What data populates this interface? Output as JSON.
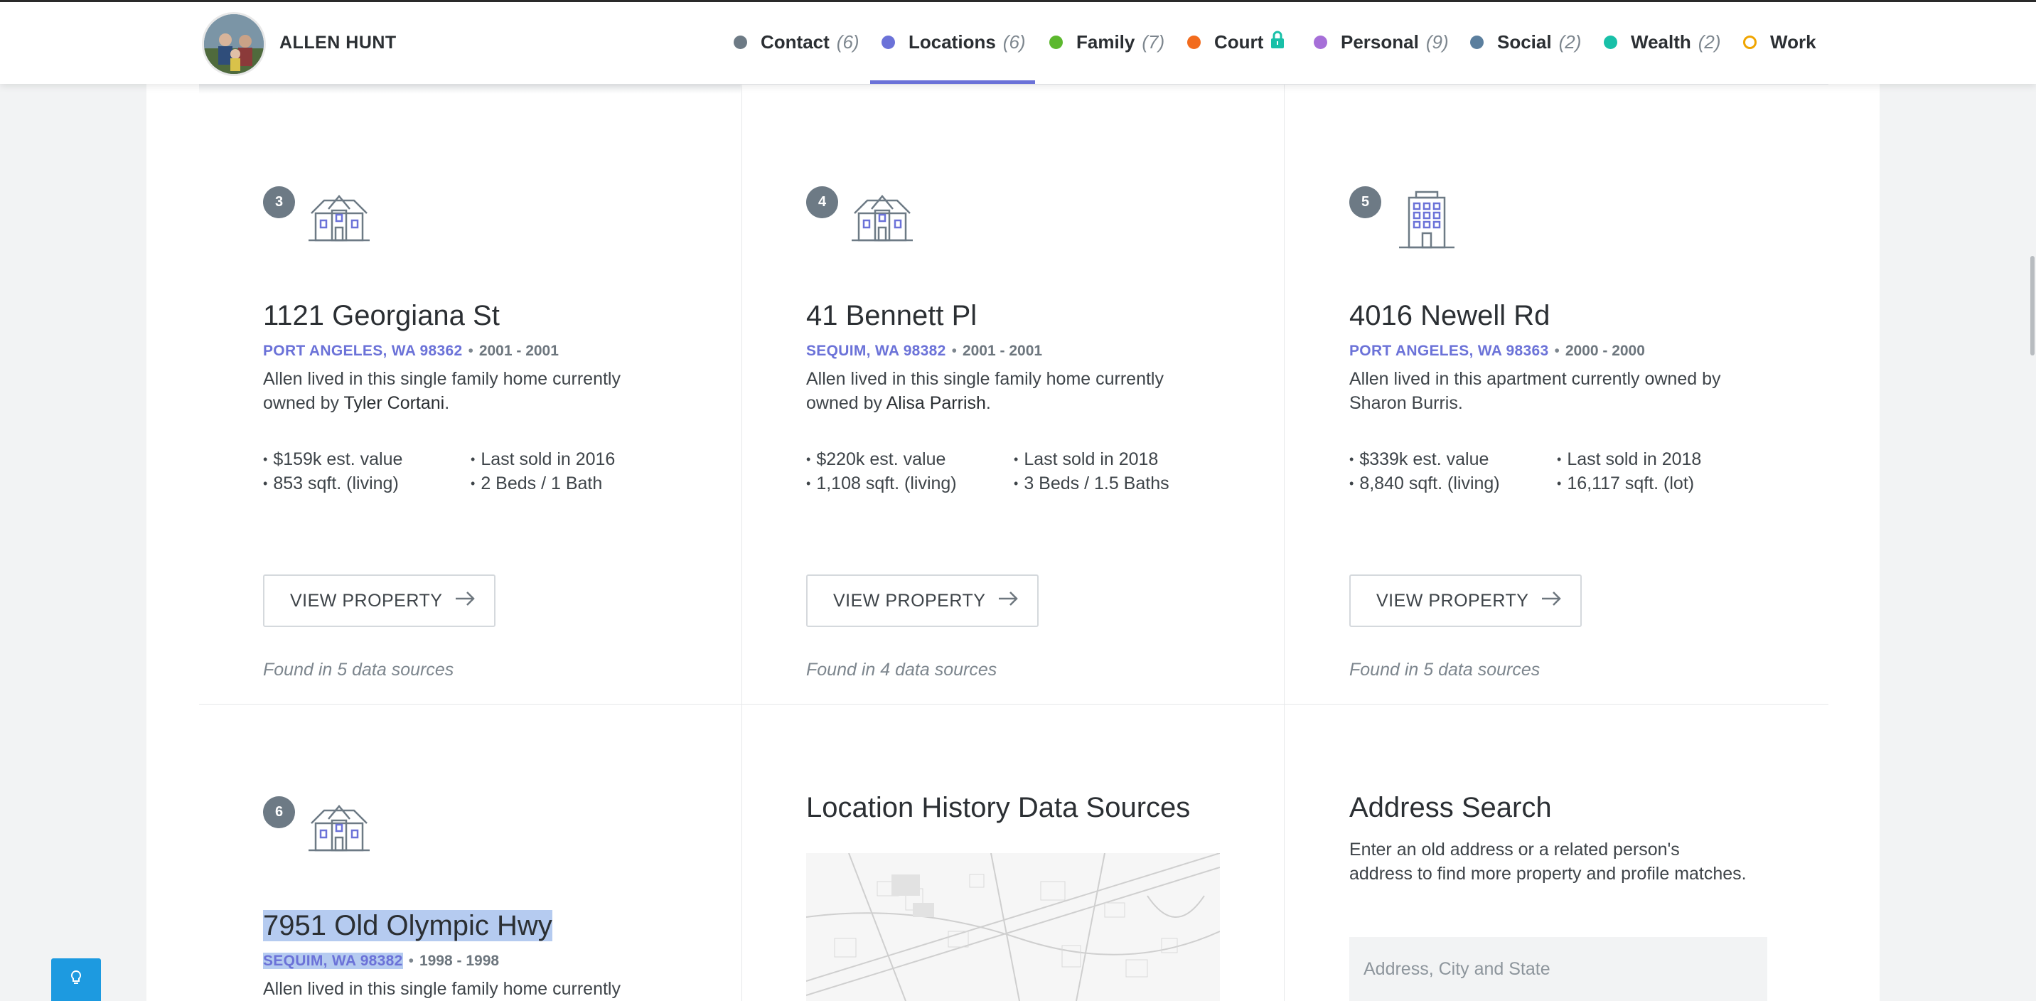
{
  "header": {
    "person_name": "ALLEN HUNT",
    "nav": [
      {
        "label": "Contact",
        "count": "(6)",
        "color": "#6d7a85"
      },
      {
        "label": "Locations",
        "count": "(6)",
        "color": "#6b72d8",
        "active": true
      },
      {
        "label": "Family",
        "count": "(7)",
        "color": "#5cb82e"
      },
      {
        "label": "Court",
        "count": "",
        "color": "#f26b1d",
        "icon": "lock-icon"
      },
      {
        "label": "Personal",
        "count": "(9)",
        "color": "#a66fd8"
      },
      {
        "label": "Social",
        "count": "(2)",
        "color": "#5b7f9e"
      },
      {
        "label": "Wealth",
        "count": "(2)",
        "color": "#18c0a8"
      },
      {
        "label": "Work",
        "count": "",
        "color": "#f0a500"
      }
    ]
  },
  "locations": [
    {
      "number": "3",
      "icon": "house-icon",
      "address": "1121 Georgiana St",
      "city": "PORT ANGELES, WA 98362",
      "years": "2001 - 2001",
      "desc_prefix": "Allen lived in this single family home currently owned by ",
      "owner": "Tyler Cortani",
      "desc_suffix": ".",
      "facts": [
        "$159k est. value",
        "Last sold in 2016",
        "853 sqft. (living)",
        "2 Beds / 1 Bath"
      ],
      "button": "VIEW PROPERTY",
      "sources": "Found in 5 data sources"
    },
    {
      "number": "4",
      "icon": "house-icon",
      "address": "41 Bennett Pl",
      "city": "SEQUIM, WA 98382",
      "years": "2001 - 2001",
      "desc_prefix": "Allen lived in this single family home currently owned by ",
      "owner": "Alisa Parrish",
      "desc_suffix": ".",
      "facts": [
        "$220k est. value",
        "Last sold in 2018",
        "1,108 sqft. (living)",
        "3 Beds / 1.5 Baths"
      ],
      "button": "VIEW PROPERTY",
      "sources": "Found in 4 data sources"
    },
    {
      "number": "5",
      "icon": "apartment-building-icon",
      "address": "4016 Newell Rd",
      "city": "PORT ANGELES, WA 98363",
      "years": "2000 - 2000",
      "desc_prefix": "Allen lived in this apartment currently owned by Sharon Burris.",
      "owner": "",
      "desc_suffix": "",
      "facts": [
        "$339k est. value",
        "Last sold in 2018",
        "8,840 sqft. (living)",
        "16,117 sqft. (lot)"
      ],
      "button": "VIEW PROPERTY",
      "sources": "Found in 5 data sources"
    },
    {
      "number": "6",
      "icon": "house-icon",
      "address": "7951 Old Olympic Hwy",
      "city": "SEQUIM, WA 98382",
      "years": "1998 - 1998",
      "desc_prefix": "Allen lived in this single family home currently",
      "owner": "",
      "desc_suffix": ""
    }
  ],
  "data_sources": {
    "title": "Location History Data Sources"
  },
  "address_search": {
    "title": "Address Search",
    "description": "Enter an old address or a related person's address to find more property and profile matches.",
    "placeholder": "Address, City and State"
  }
}
